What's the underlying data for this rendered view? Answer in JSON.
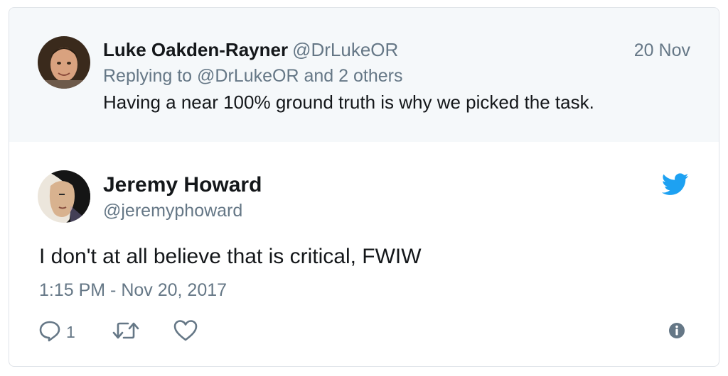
{
  "parent_tweet": {
    "author_name": "Luke Oakden-Rayner",
    "author_handle": "@DrLukeOR",
    "date": "20 Nov",
    "reply_prefix": "Replying to ",
    "reply_mention": "@DrLukeOR",
    "reply_suffix": " and 2 others",
    "text": "Having a near 100% ground truth is why we picked the task."
  },
  "main_tweet": {
    "author_name": "Jeremy Howard",
    "author_handle": "@jeremyphoward",
    "text": "I don't at all believe that is critical, FWIW",
    "timestamp": "1:15 PM - Nov 20, 2017",
    "reply_count": "1"
  },
  "icons": {
    "brand": "twitter-bird-icon",
    "reply": "reply-icon",
    "retweet": "retweet-icon",
    "like": "heart-icon",
    "info": "info-icon"
  },
  "colors": {
    "twitter_blue": "#1da1f2",
    "text_primary": "#14171a",
    "text_secondary": "#657786",
    "parent_background": "#f5f8fa"
  }
}
